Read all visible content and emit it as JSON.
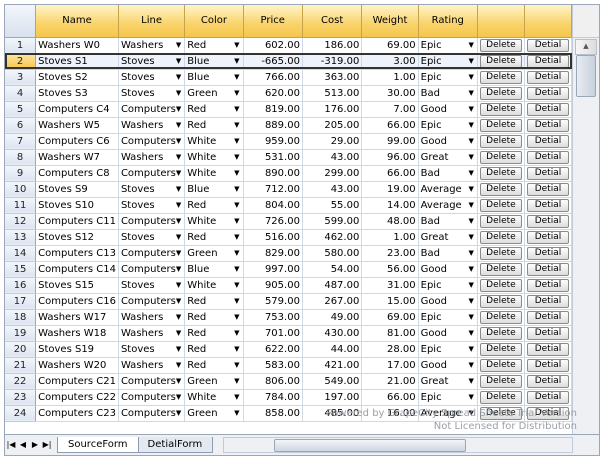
{
  "columns": [
    "Name",
    "Line",
    "Color",
    "Price",
    "Cost",
    "Weight",
    "Rating",
    "",
    ""
  ],
  "buttons": {
    "delete": "Delete",
    "detail": "Detial"
  },
  "rows": [
    {
      "n": "1",
      "name": "Washers W0",
      "line": "Washers",
      "color": "Red",
      "price": "602.00",
      "cost": "186.00",
      "weight": "69.00",
      "rating": "Epic"
    },
    {
      "n": "2",
      "name": "Stoves S1",
      "line": "Stoves",
      "color": "Blue",
      "price": "-665.00",
      "cost": "-319.00",
      "weight": "3.00",
      "rating": "Epic"
    },
    {
      "n": "3",
      "name": "Stoves S2",
      "line": "Stoves",
      "color": "Blue",
      "price": "766.00",
      "cost": "363.00",
      "weight": "1.00",
      "rating": "Epic"
    },
    {
      "n": "4",
      "name": "Stoves S3",
      "line": "Stoves",
      "color": "Green",
      "price": "620.00",
      "cost": "513.00",
      "weight": "30.00",
      "rating": "Bad"
    },
    {
      "n": "5",
      "name": "Computers C4",
      "line": "Computers",
      "color": "Red",
      "price": "819.00",
      "cost": "176.00",
      "weight": "7.00",
      "rating": "Good"
    },
    {
      "n": "6",
      "name": "Washers W5",
      "line": "Washers",
      "color": "Red",
      "price": "889.00",
      "cost": "205.00",
      "weight": "66.00",
      "rating": "Epic"
    },
    {
      "n": "7",
      "name": "Computers C6",
      "line": "Computers",
      "color": "White",
      "price": "959.00",
      "cost": "29.00",
      "weight": "99.00",
      "rating": "Good"
    },
    {
      "n": "8",
      "name": "Washers W7",
      "line": "Washers",
      "color": "White",
      "price": "531.00",
      "cost": "43.00",
      "weight": "96.00",
      "rating": "Great"
    },
    {
      "n": "9",
      "name": "Computers C8",
      "line": "Computers",
      "color": "White",
      "price": "890.00",
      "cost": "299.00",
      "weight": "66.00",
      "rating": "Bad"
    },
    {
      "n": "10",
      "name": "Stoves S9",
      "line": "Stoves",
      "color": "Blue",
      "price": "712.00",
      "cost": "43.00",
      "weight": "19.00",
      "rating": "Average"
    },
    {
      "n": "11",
      "name": "Stoves S10",
      "line": "Stoves",
      "color": "Red",
      "price": "804.00",
      "cost": "55.00",
      "weight": "14.00",
      "rating": "Average"
    },
    {
      "n": "12",
      "name": "Computers C11",
      "line": "Computers",
      "color": "White",
      "price": "726.00",
      "cost": "599.00",
      "weight": "48.00",
      "rating": "Bad"
    },
    {
      "n": "13",
      "name": "Stoves S12",
      "line": "Stoves",
      "color": "Red",
      "price": "516.00",
      "cost": "462.00",
      "weight": "1.00",
      "rating": "Great"
    },
    {
      "n": "14",
      "name": "Computers C13",
      "line": "Computers",
      "color": "Green",
      "price": "829.00",
      "cost": "580.00",
      "weight": "23.00",
      "rating": "Bad"
    },
    {
      "n": "15",
      "name": "Computers C14",
      "line": "Computers",
      "color": "Blue",
      "price": "997.00",
      "cost": "54.00",
      "weight": "56.00",
      "rating": "Good"
    },
    {
      "n": "16",
      "name": "Stoves S15",
      "line": "Stoves",
      "color": "White",
      "price": "905.00",
      "cost": "487.00",
      "weight": "31.00",
      "rating": "Epic"
    },
    {
      "n": "17",
      "name": "Computers C16",
      "line": "Computers",
      "color": "Red",
      "price": "579.00",
      "cost": "267.00",
      "weight": "15.00",
      "rating": "Good"
    },
    {
      "n": "18",
      "name": "Washers W17",
      "line": "Washers",
      "color": "Red",
      "price": "753.00",
      "cost": "49.00",
      "weight": "69.00",
      "rating": "Epic"
    },
    {
      "n": "19",
      "name": "Washers W18",
      "line": "Washers",
      "color": "Red",
      "price": "701.00",
      "cost": "430.00",
      "weight": "81.00",
      "rating": "Good"
    },
    {
      "n": "20",
      "name": "Stoves S19",
      "line": "Stoves",
      "color": "Red",
      "price": "622.00",
      "cost": "44.00",
      "weight": "28.00",
      "rating": "Epic"
    },
    {
      "n": "21",
      "name": "Washers W20",
      "line": "Washers",
      "color": "Red",
      "price": "583.00",
      "cost": "421.00",
      "weight": "17.00",
      "rating": "Good"
    },
    {
      "n": "22",
      "name": "Computers C21",
      "line": "Computers",
      "color": "Green",
      "price": "806.00",
      "cost": "549.00",
      "weight": "21.00",
      "rating": "Great"
    },
    {
      "n": "23",
      "name": "Computers C22",
      "line": "Computers",
      "color": "White",
      "price": "784.00",
      "cost": "197.00",
      "weight": "66.00",
      "rating": "Epic"
    },
    {
      "n": "24",
      "name": "Computers C23",
      "line": "Computers",
      "color": "Green",
      "price": "858.00",
      "cost": "485.00",
      "weight": "16.00",
      "rating": "Average"
    }
  ],
  "sheet_tabs": [
    "SourceForm",
    "DetialForm"
  ],
  "watermark": {
    "line1": "Powered by GrapeCity Spread Sheets Trial Version",
    "line2": "Not Licensed for Distribution"
  },
  "icons": {
    "first": "first-page-icon",
    "prev": "prev-page-icon",
    "next": "next-page-icon",
    "last": "last-page-icon",
    "dropdown": "dropdown-arrow-icon"
  },
  "colors": {
    "header": "#f9d36a",
    "gridline": "#d0d7e5",
    "rowheader": "#dde5f0"
  }
}
